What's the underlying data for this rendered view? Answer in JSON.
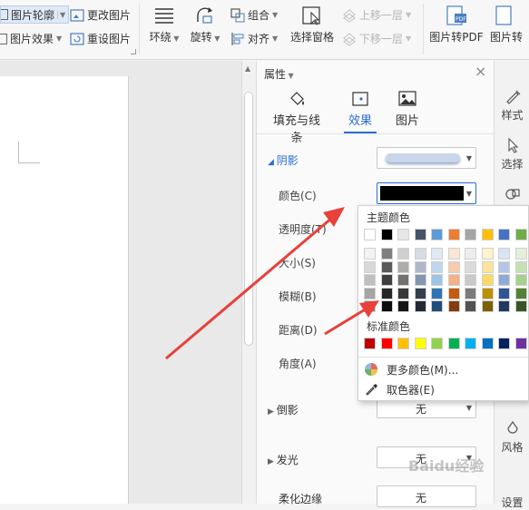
{
  "ribbon": {
    "picture_outline": "图片轮廓",
    "picture_effect": "图片效果",
    "change_picture": "更改图片",
    "reset_picture": "重设图片",
    "wrap": "环绕",
    "rotate": "旋转",
    "group": "组合",
    "align": "对齐",
    "selection_pane": "选择窗格",
    "bring_forward": "上移一层",
    "send_backward": "下移一层",
    "picture_to_pdf": "图片转PDF",
    "picture_more": "图片转"
  },
  "panel": {
    "title": "属性",
    "tabs": [
      {
        "label": "填充与线条"
      },
      {
        "label": "效果"
      },
      {
        "label": "图片"
      }
    ],
    "shadow_section": "阴影",
    "color_label": "颜色(C)",
    "transparency_label": "透明度(T)",
    "size_label": "大小(S)",
    "blur_label": "模糊(B)",
    "distance_label": "距离(D)",
    "angle_label": "角度(A)",
    "reflection_section": "倒影",
    "reflection_value": "无",
    "glow_section": "发光",
    "glow_value": "无",
    "next_section": "柔化边缘",
    "next_value": "无"
  },
  "color_popup": {
    "theme_colors_label": "主题颜色",
    "standard_colors_label": "标准颜色",
    "more_colors": "更多颜色(M)...",
    "eyedropper": "取色器(E)",
    "theme_top": [
      "#ffffff",
      "#000000",
      "#e7e6e6",
      "#44546a",
      "#5b9bd5",
      "#ed7d31",
      "#a5a5a5",
      "#ffc000",
      "#4472c4",
      "#70ad47"
    ],
    "theme_shades": [
      [
        "#f2f2f2",
        "#7f7f7f",
        "#d0cece",
        "#d6dce4",
        "#deebf6",
        "#fbe5d5",
        "#ededed",
        "#fff2cc",
        "#dae3f3",
        "#e2efd9"
      ],
      [
        "#d8d8d8",
        "#595959",
        "#aeabab",
        "#adb9ca",
        "#bdd7ee",
        "#f7cbac",
        "#dbdbdb",
        "#fee599",
        "#b4c6e7",
        "#c5e0b3"
      ],
      [
        "#bfbfbf",
        "#3f3f3f",
        "#757070",
        "#8496b0",
        "#9dc3e6",
        "#f4b183",
        "#c9c9c9",
        "#ffd965",
        "#8eaadb",
        "#a8d08d"
      ],
      [
        "#a5a5a5",
        "#262626",
        "#3a3838",
        "#323f4f",
        "#2e75b5",
        "#c55a11",
        "#7b7b7b",
        "#bf9000",
        "#2f5496",
        "#538135"
      ],
      [
        "#7f7f7f",
        "#0c0c0c",
        "#171616",
        "#222a35",
        "#1e4e79",
        "#833c0b",
        "#525252",
        "#7f6000",
        "#1f3864",
        "#375623"
      ]
    ],
    "standard": [
      "#c00000",
      "#ff0000",
      "#ffc000",
      "#ffff00",
      "#92d050",
      "#00b050",
      "#00b0f0",
      "#0070c0",
      "#002060",
      "#7030a0"
    ]
  },
  "right_sidebar": {
    "style": "样式",
    "select": "选择",
    "layout": "风格",
    "settings": "设置"
  },
  "watermark": "Baidu经验",
  "colors": {
    "accent": "#2b6cd4",
    "arrow": "#e8413a",
    "shadow_color": "#000000"
  }
}
